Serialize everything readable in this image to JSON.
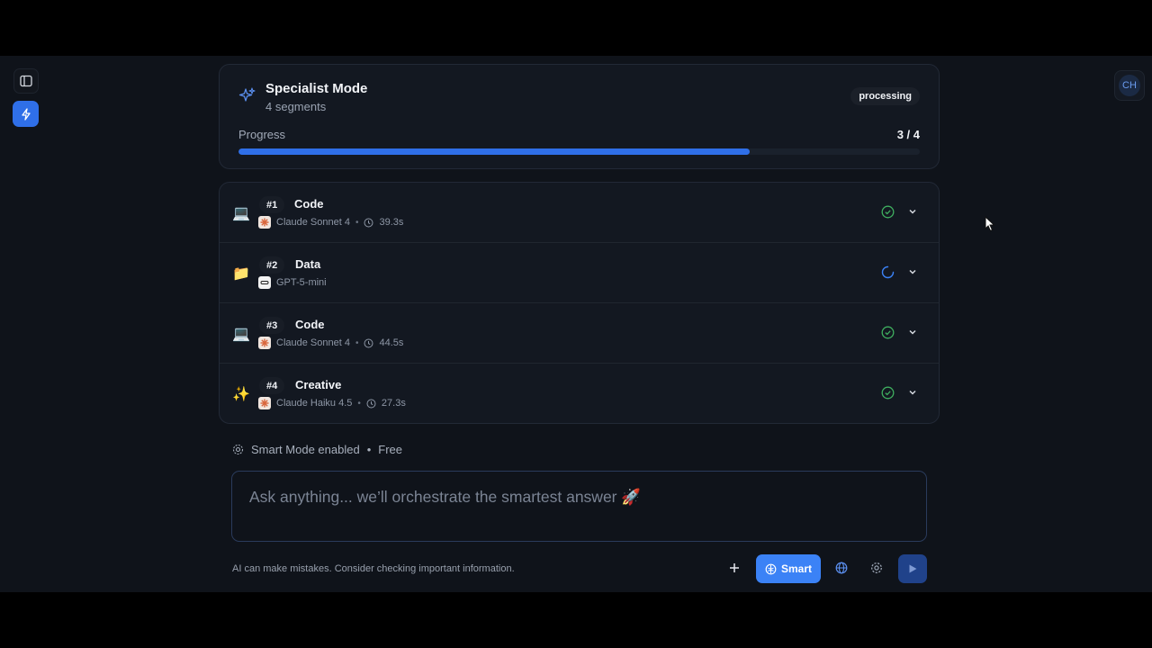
{
  "header": {
    "title": "Specialist Mode",
    "subtitle": "4 segments",
    "status": "processing",
    "progress_label": "Progress",
    "progress_count": "3 / 4",
    "progress_fraction": 0.75
  },
  "user": {
    "initials": "CH"
  },
  "segments": [
    {
      "number": "#1",
      "name": "Code",
      "emoji": "💻",
      "model": "Claude Sonnet 4",
      "model_icon": "claude-icon",
      "duration": "39.3s",
      "status": "complete"
    },
    {
      "number": "#2",
      "name": "Data",
      "emoji": "📁",
      "model": "GPT-5-mini",
      "model_icon": "openai-icon",
      "duration": "",
      "status": "loading"
    },
    {
      "number": "#3",
      "name": "Code",
      "emoji": "💻",
      "model": "Claude Sonnet 4",
      "model_icon": "claude-icon",
      "duration": "44.5s",
      "status": "complete"
    },
    {
      "number": "#4",
      "name": "Creative",
      "emoji": "✨",
      "model": "Claude Haiku 4.5",
      "model_icon": "claude-icon",
      "duration": "27.3s",
      "status": "complete"
    }
  ],
  "smart_mode": {
    "label": "Smart Mode enabled",
    "separator": "•",
    "plan": "Free"
  },
  "input": {
    "placeholder": "Ask anything... we’ll orchestrate the smartest answer 🚀"
  },
  "footer": {
    "disclaimer": "AI can make mistakes. Consider checking important information.",
    "smart_button": "Smart"
  },
  "colors": {
    "accent": "#3b82f6",
    "success": "#3fae5f",
    "background": "#0f131a"
  }
}
